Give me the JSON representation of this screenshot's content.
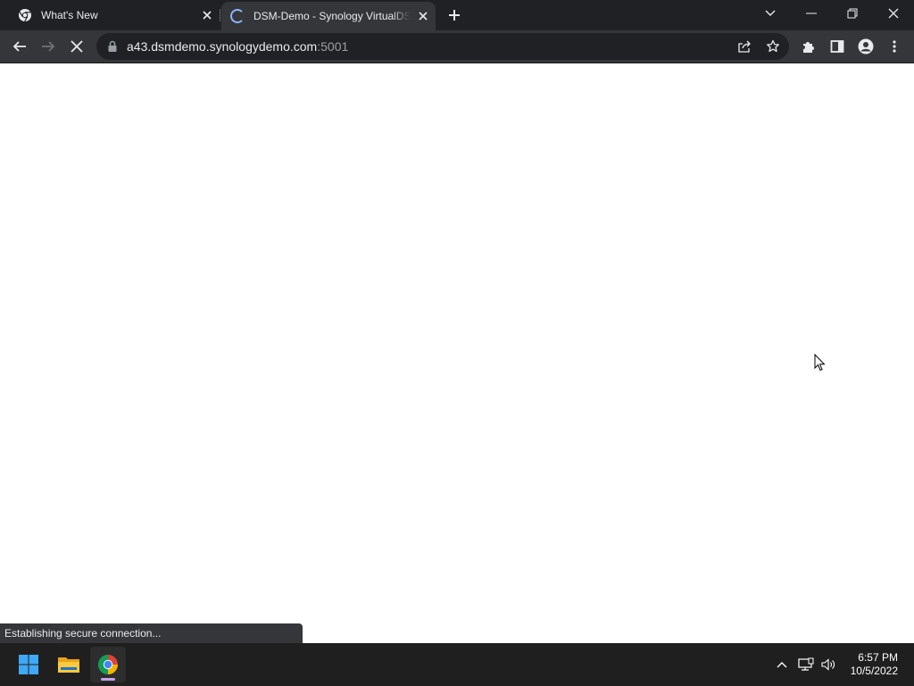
{
  "browser": {
    "tabs": [
      {
        "title": "What's New",
        "active": false,
        "favicon": "chrome-icon"
      },
      {
        "title": "DSM-Demo - Synology VirtualDSM",
        "active": true,
        "favicon": "loading-spinner-icon"
      }
    ],
    "new_tab_icon": "plus-icon",
    "window_controls": [
      "tab-search-icon",
      "minimize-icon",
      "restore-icon",
      "close-icon"
    ],
    "toolbar": {
      "back_icon": "back-arrow-icon",
      "forward_icon": "forward-arrow-icon",
      "stop_icon": "stop-x-icon",
      "url_host": "a43.dsmdemo.synologydemo.com",
      "url_port": ":5001",
      "lock_icon": "lock-icon",
      "share_icon": "share-icon",
      "bookmark_icon": "star-icon",
      "extensions_icon": "puzzle-icon",
      "side_panel_icon": "side-panel-icon",
      "profile_icon": "profile-icon",
      "menu_icon": "kebab-menu-icon"
    },
    "status_text": "Establishing secure connection...",
    "colors": {
      "tab_strip": "#202124",
      "toolbar": "#35363a",
      "omnibox": "#202124",
      "spinner": "#8ab4f8"
    }
  },
  "taskbar": {
    "apps": [
      "windows-start-icon",
      "file-explorer-icon",
      "chrome-icon"
    ],
    "active_app": "chrome-icon",
    "tray": [
      "chevron-up-icon",
      "network-icon",
      "volume-icon"
    ],
    "time": "6:57 PM",
    "date": "10/5/2022"
  }
}
